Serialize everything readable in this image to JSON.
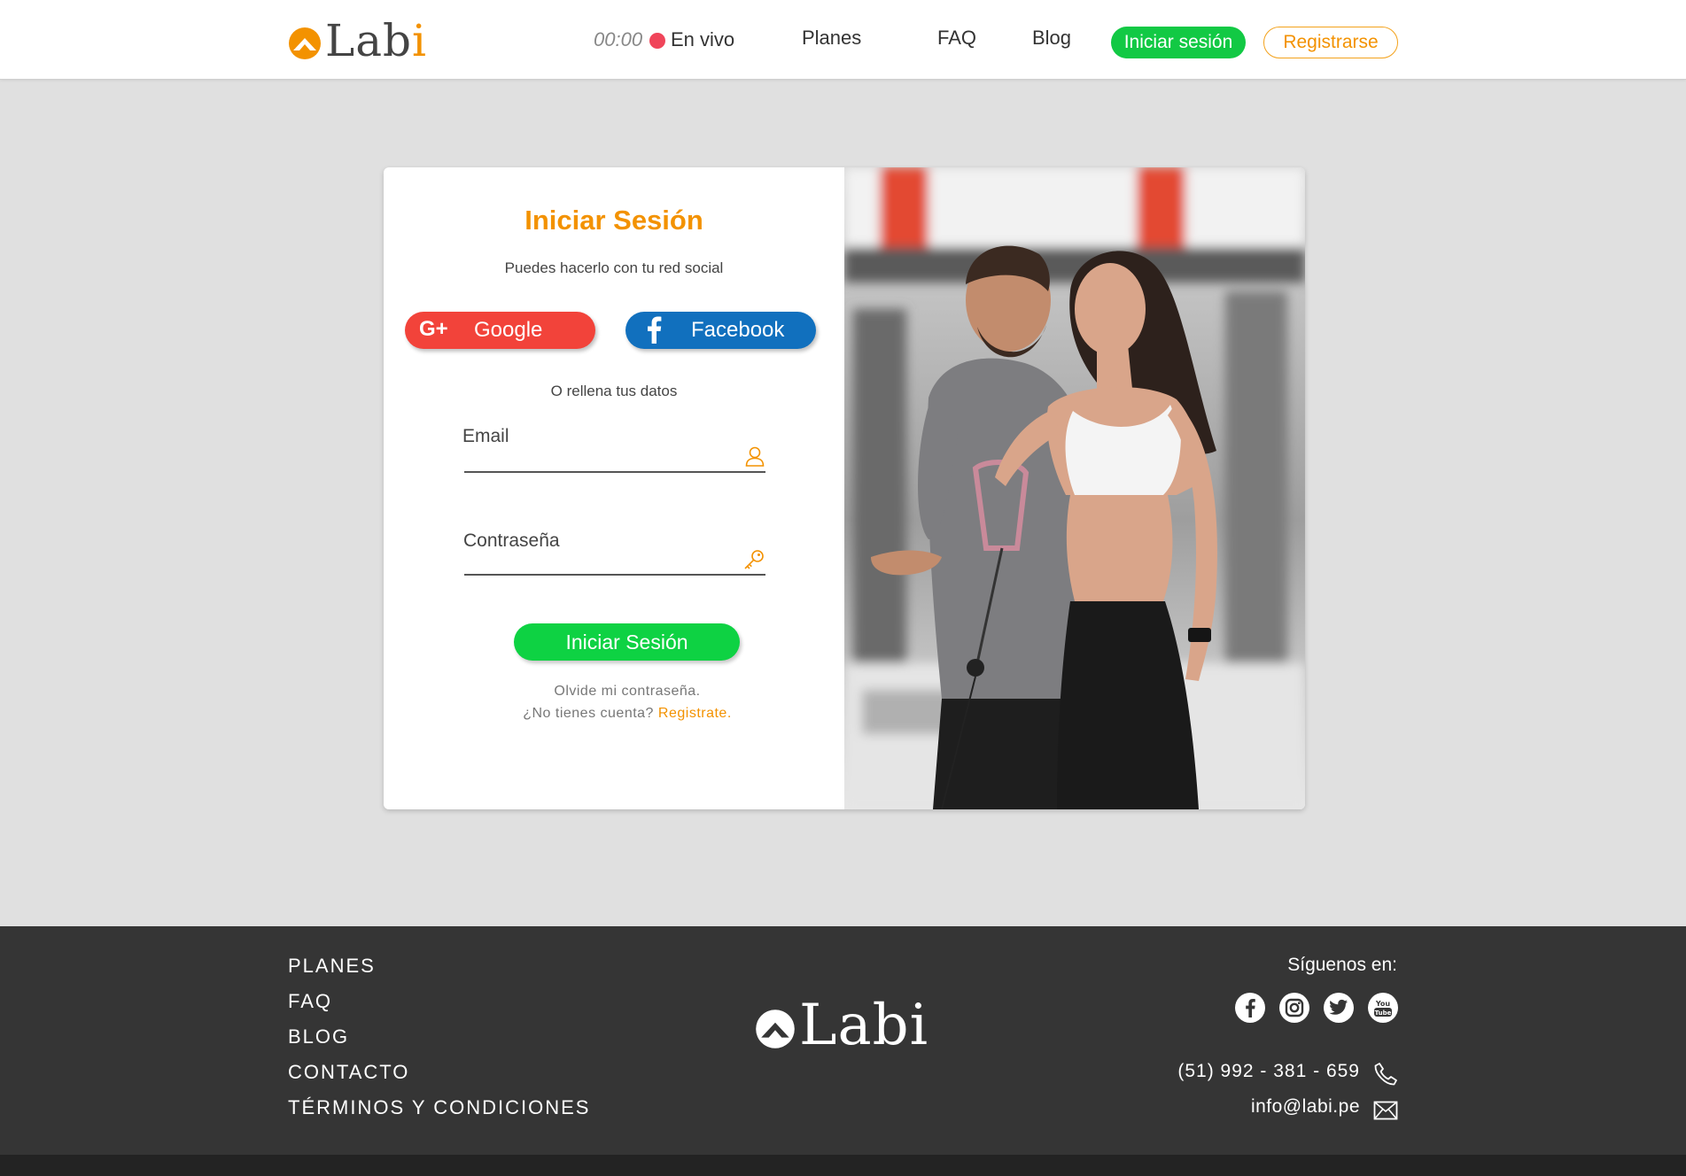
{
  "header": {
    "logo_text": "Labi",
    "timer": "00:00",
    "live_label": "En vivo",
    "nav": {
      "planes": "Planes",
      "faq": "FAQ",
      "blog": "Blog"
    },
    "login_button": "Iniciar sesión",
    "register_button": "Registrarse"
  },
  "login": {
    "title": "Iniciar Sesión",
    "subtitle": "Puedes hacerlo con tu red social",
    "google_label": "Google",
    "facebook_label": "Facebook",
    "or_text": "O rellena tus datos",
    "email_label": "Email",
    "password_label": "Contraseña",
    "submit_label": "Iniciar Sesión",
    "forgot_text": "Olvide mi contraseña.",
    "no_account_text": "¿No tienes cuenta?",
    "register_link": "Registrate."
  },
  "footer": {
    "links": {
      "planes": "PLANES",
      "faq": "FAQ",
      "blog": "BLOG",
      "contacto": "CONTACTO",
      "terms": "TÉRMINOS Y CONDICIONES"
    },
    "logo_text": "Labi",
    "follow_label": "Síguenos en:",
    "social": [
      "facebook-icon",
      "instagram-icon",
      "twitter-icon",
      "youtube-icon"
    ],
    "phone": "(51) 992 - 381 - 659",
    "email": "info@labi.pe"
  },
  "colors": {
    "brand_orange": "#f39200",
    "green": "#12c944",
    "google_red": "#f2433a",
    "facebook_blue": "#1170be",
    "footer_bg": "#353535"
  }
}
